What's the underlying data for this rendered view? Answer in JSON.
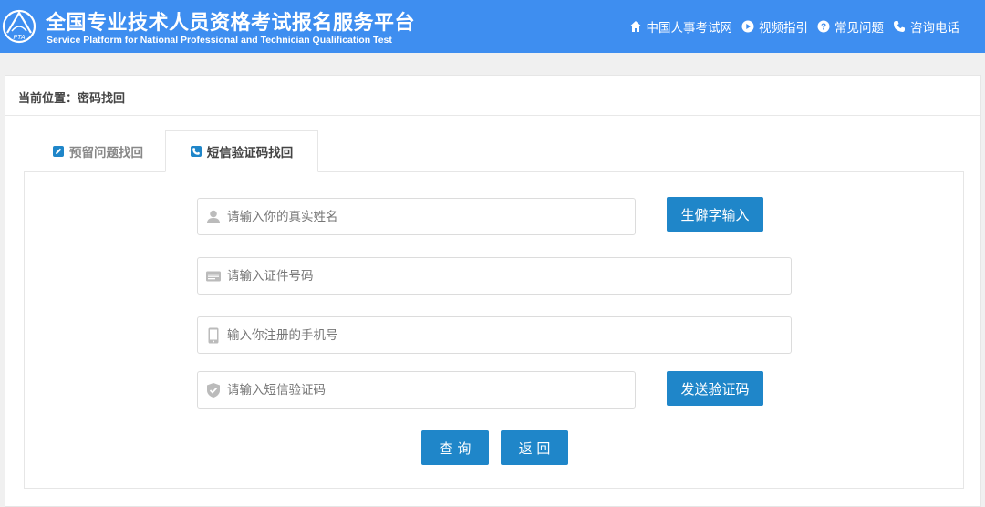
{
  "header": {
    "title": "全国专业技术人员资格考试报名服务平台",
    "subtitle": "Service Platform for National Professional and Technician Qualification Test",
    "logo_text": "PTA",
    "nav": [
      {
        "label": "中国人事考试网",
        "icon": "home-icon"
      },
      {
        "label": "视频指引",
        "icon": "play-icon"
      },
      {
        "label": "常见问题",
        "icon": "question-icon"
      },
      {
        "label": "咨询电话",
        "icon": "phone-icon"
      }
    ]
  },
  "breadcrumb": "当前位置：密码找回",
  "tabs": [
    {
      "label": "预留问题找回",
      "icon": "edit-icon",
      "active": false
    },
    {
      "label": "短信验证码找回",
      "icon": "phone-icon",
      "active": true
    }
  ],
  "form": {
    "name_placeholder": "请输入你的真实姓名",
    "rare_char_button": "生僻字输入",
    "id_placeholder": "请输入证件号码",
    "phone_placeholder": "输入你注册的手机号",
    "code_placeholder": "请输入短信验证码",
    "send_code_button": "发送验证码",
    "query_button": "查 询",
    "back_button": "返 回"
  },
  "colors": {
    "header_bg": "#3e8ef0",
    "button_bg": "#1f86c9"
  }
}
